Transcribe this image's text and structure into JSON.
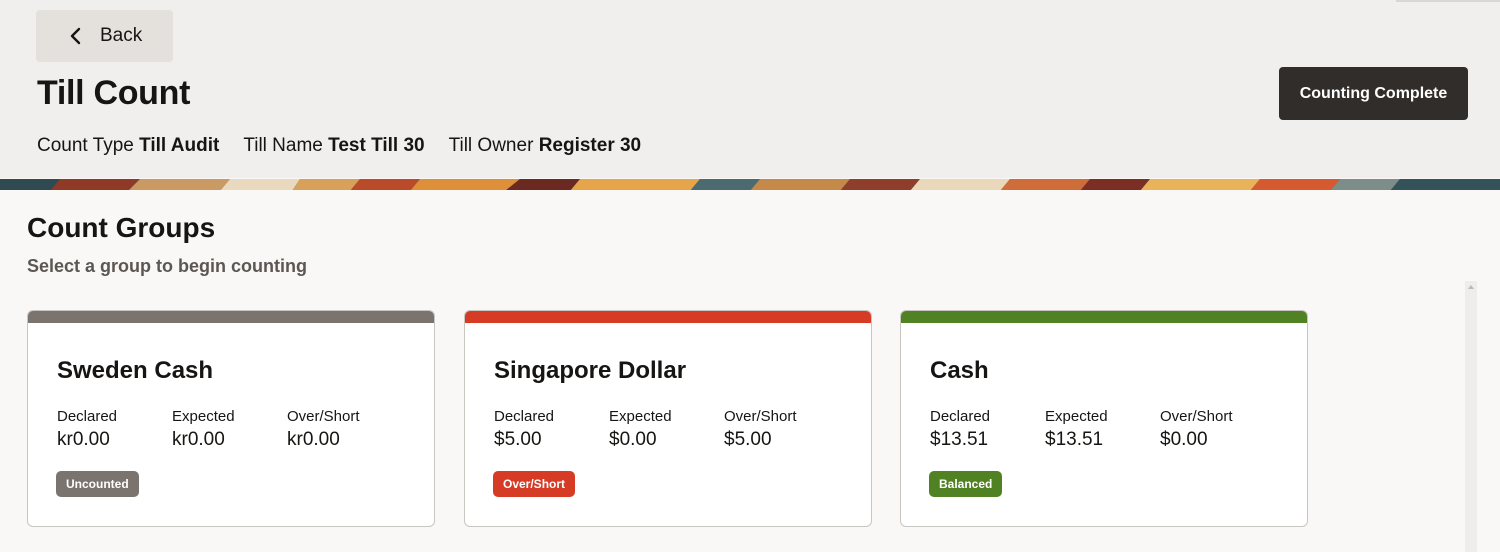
{
  "header": {
    "back_label": "Back",
    "title": "Till Count",
    "complete_label": "Counting Complete",
    "meta": [
      {
        "key": "Count Type",
        "value": "Till Audit"
      },
      {
        "key": "Till Name",
        "value": "Test Till 30"
      },
      {
        "key": "Till Owner",
        "value": "Register 30"
      }
    ]
  },
  "section": {
    "title": "Count Groups",
    "subtitle": "Select a group to begin counting"
  },
  "labels": {
    "declared": "Declared",
    "expected": "Expected",
    "over_short": "Over/Short"
  },
  "groups": [
    {
      "name": "Sweden Cash",
      "declared": "kr0.00",
      "expected": "kr0.00",
      "over_short": "kr0.00",
      "status": "Uncounted",
      "color": "#7a736e"
    },
    {
      "name": "Singapore Dollar",
      "declared": "$5.00",
      "expected": "$0.00",
      "over_short": "$5.00",
      "status": "Over/Short",
      "color": "#d63b25"
    },
    {
      "name": "Cash",
      "declared": "$13.51",
      "expected": "$13.51",
      "over_short": "$0.00",
      "status": "Balanced",
      "color": "#508223"
    }
  ],
  "icons": {
    "back": "chevron-left-icon",
    "scroll": "scroll-up-arrow-icon"
  }
}
